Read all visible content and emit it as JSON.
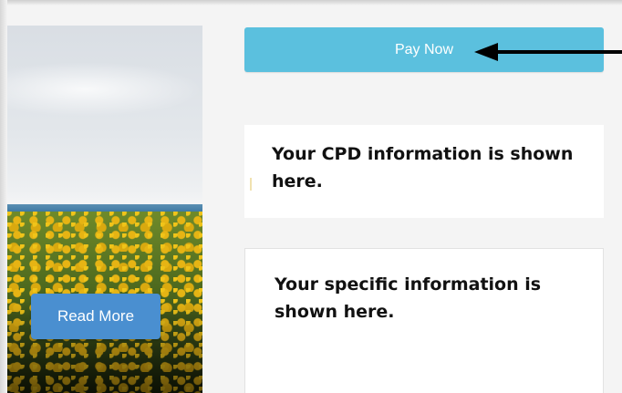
{
  "hero": {
    "read_more_label": "Read More"
  },
  "payment": {
    "pay_now_label": "Pay Now"
  },
  "annotation": {
    "icon": "left-arrow-icon"
  },
  "panels": {
    "cpd_text": "Your CPD information is shown here.",
    "specific_text": "Your specific information is shown here."
  },
  "colors": {
    "pay_now": "#5bc0de",
    "read_more": "#4a8fd0",
    "panel_bg": "#ffffff",
    "page_bg": "#f4f4f4"
  }
}
